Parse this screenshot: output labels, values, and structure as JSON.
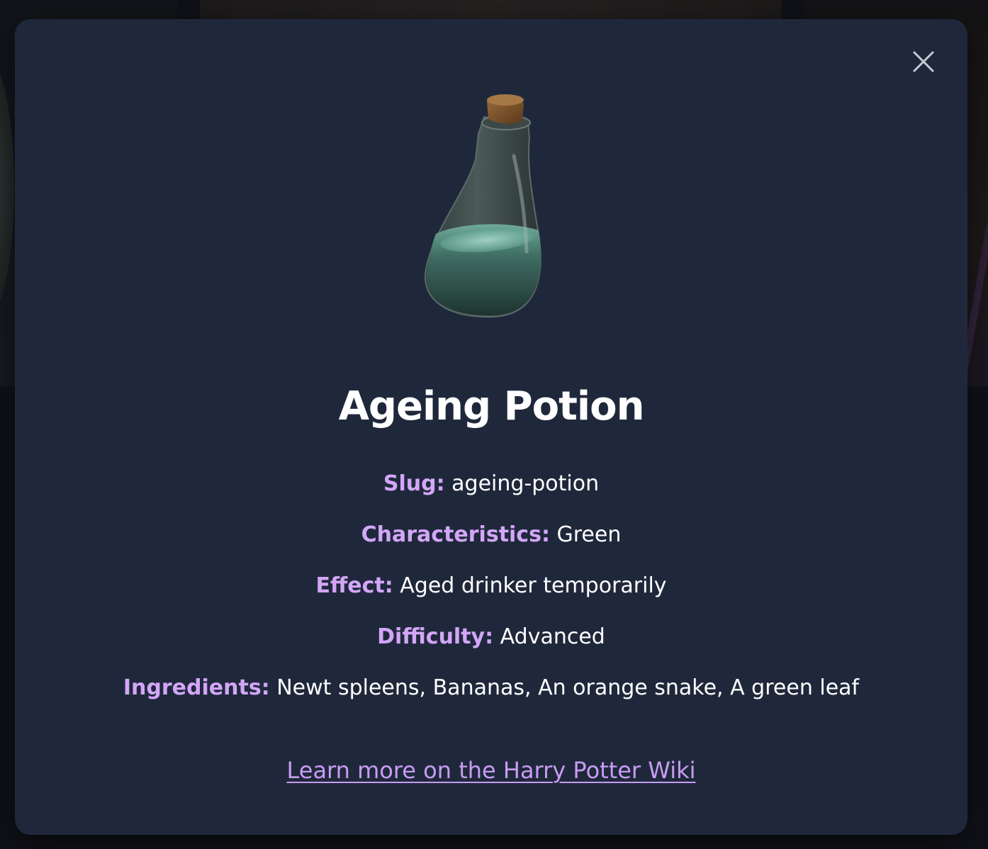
{
  "modal": {
    "title": "Ageing Potion",
    "image_alt": "potion-bottle-image",
    "fields": {
      "slug": {
        "label": "Slug:",
        "value": "ageing-potion"
      },
      "characteristics": {
        "label": "Characteristics:",
        "value": "Green"
      },
      "effect": {
        "label": "Effect:",
        "value": "Aged drinker temporarily"
      },
      "difficulty": {
        "label": "Difficulty:",
        "value": "Advanced"
      },
      "ingredients": {
        "label": "Ingredients:",
        "value": "Newt spleens, Bananas, An orange snake, A green leaf"
      }
    },
    "wiki_link_text": "Learn more on the Harry Potter Wiki",
    "close_icon": "close-icon"
  },
  "colors": {
    "modal_bg": "#1f283b",
    "label_purple": "#d3a6f7",
    "link_purple": "#c89cf2",
    "text_white": "#ffffff"
  }
}
